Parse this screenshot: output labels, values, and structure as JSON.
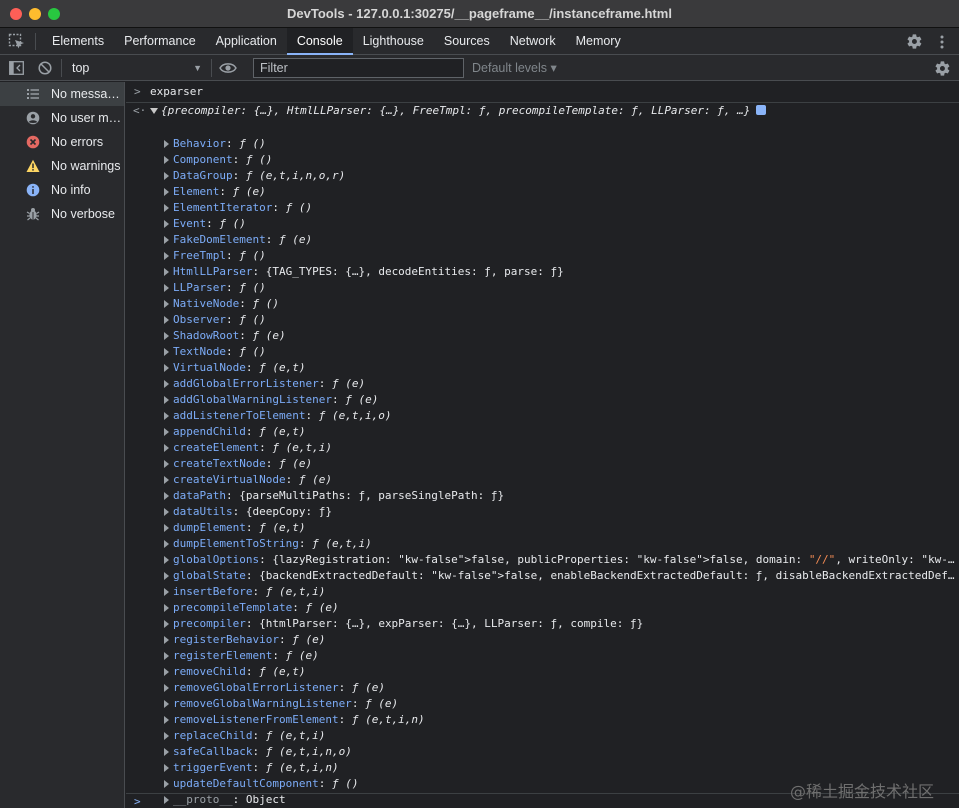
{
  "window": {
    "title": "DevTools - 127.0.0.1:30275/__pageframe__/instanceframe.html"
  },
  "tabs": [
    {
      "label": "Elements"
    },
    {
      "label": "Performance"
    },
    {
      "label": "Application"
    },
    {
      "label": "Console",
      "active": true
    },
    {
      "label": "Lighthouse"
    },
    {
      "label": "Sources"
    },
    {
      "label": "Network"
    },
    {
      "label": "Memory"
    }
  ],
  "toolbar": {
    "context": "top",
    "filter_placeholder": "Filter",
    "levels": "Default levels ▾"
  },
  "sidebar": {
    "items": [
      {
        "label": "No messages",
        "icon": "list-icon"
      },
      {
        "label": "No user me...",
        "icon": "user-icon"
      },
      {
        "label": "No errors",
        "icon": "error-icon"
      },
      {
        "label": "No warnings",
        "icon": "warning-icon"
      },
      {
        "label": "No info",
        "icon": "info-icon"
      },
      {
        "label": "No verbose",
        "icon": "bug-icon"
      }
    ]
  },
  "console": {
    "prompt": ">",
    "input": "exparser",
    "result_arrow": "<·",
    "result_summary": "{precompiler: {…}, HtmlLLParser: {…}, FreeTmpl: ƒ, precompileTemplate: ƒ, LLParser: ƒ, …}",
    "properties": [
      {
        "key": "Behavior",
        "value": "ƒ ()",
        "fn": true
      },
      {
        "key": "Component",
        "value": "ƒ ()",
        "fn": true
      },
      {
        "key": "DataGroup",
        "value": "ƒ (e,t,i,n,o,r)",
        "fn": true
      },
      {
        "key": "Element",
        "value": "ƒ (e)",
        "fn": true
      },
      {
        "key": "ElementIterator",
        "value": "ƒ ()",
        "fn": true
      },
      {
        "key": "Event",
        "value": "ƒ ()",
        "fn": true
      },
      {
        "key": "FakeDomElement",
        "value": "ƒ (e)",
        "fn": true
      },
      {
        "key": "FreeTmpl",
        "value": "ƒ ()",
        "fn": true
      },
      {
        "key": "HtmlLLParser",
        "value": "{TAG_TYPES: {…}, decodeEntities: ƒ, parse: ƒ}",
        "fn": false
      },
      {
        "key": "LLParser",
        "value": "ƒ ()",
        "fn": true
      },
      {
        "key": "NativeNode",
        "value": "ƒ ()",
        "fn": true
      },
      {
        "key": "Observer",
        "value": "ƒ ()",
        "fn": true
      },
      {
        "key": "ShadowRoot",
        "value": "ƒ (e)",
        "fn": true
      },
      {
        "key": "TextNode",
        "value": "ƒ ()",
        "fn": true
      },
      {
        "key": "VirtualNode",
        "value": "ƒ (e,t)",
        "fn": true
      },
      {
        "key": "addGlobalErrorListener",
        "value": "ƒ (e)",
        "fn": true
      },
      {
        "key": "addGlobalWarningListener",
        "value": "ƒ (e)",
        "fn": true
      },
      {
        "key": "addListenerToElement",
        "value": "ƒ (e,t,i,o)",
        "fn": true
      },
      {
        "key": "appendChild",
        "value": "ƒ (e,t)",
        "fn": true
      },
      {
        "key": "createElement",
        "value": "ƒ (e,t,i)",
        "fn": true
      },
      {
        "key": "createTextNode",
        "value": "ƒ (e)",
        "fn": true
      },
      {
        "key": "createVirtualNode",
        "value": "ƒ (e)",
        "fn": true
      },
      {
        "key": "dataPath",
        "value": "{parseMultiPaths: ƒ, parseSinglePath: ƒ}",
        "fn": false
      },
      {
        "key": "dataUtils",
        "value": "{deepCopy: ƒ}",
        "fn": false
      },
      {
        "key": "dumpElement",
        "value": "ƒ (e,t)",
        "fn": true
      },
      {
        "key": "dumpElementToString",
        "value": "ƒ (e,t,i)",
        "fn": true
      },
      {
        "key": "globalOptions",
        "value": "{lazyRegistration: false, publicProperties: false, domain: \"//\", writeOnly: false, availability: …",
        "fn": false
      },
      {
        "key": "globalState",
        "value": "{backendExtractedDefault: false, enableBackendExtractedDefault: ƒ, disableBackendExtractedDefault: …",
        "fn": false
      },
      {
        "key": "insertBefore",
        "value": "ƒ (e,t,i)",
        "fn": true
      },
      {
        "key": "precompileTemplate",
        "value": "ƒ (e)",
        "fn": true
      },
      {
        "key": "precompiler",
        "value": "{htmlParser: {…}, expParser: {…}, LLParser: ƒ, compile: ƒ}",
        "fn": false
      },
      {
        "key": "registerBehavior",
        "value": "ƒ (e)",
        "fn": true
      },
      {
        "key": "registerElement",
        "value": "ƒ (e)",
        "fn": true
      },
      {
        "key": "removeChild",
        "value": "ƒ (e,t)",
        "fn": true
      },
      {
        "key": "removeGlobalErrorListener",
        "value": "ƒ (e)",
        "fn": true
      },
      {
        "key": "removeGlobalWarningListener",
        "value": "ƒ (e)",
        "fn": true
      },
      {
        "key": "removeListenerFromElement",
        "value": "ƒ (e,t,i,n)",
        "fn": true
      },
      {
        "key": "replaceChild",
        "value": "ƒ (e,t,i)",
        "fn": true
      },
      {
        "key": "safeCallback",
        "value": "ƒ (e,t,i,n,o)",
        "fn": true
      },
      {
        "key": "triggerEvent",
        "value": "ƒ (e,t,i,n)",
        "fn": true
      },
      {
        "key": "updateDefaultComponent",
        "value": "ƒ ()",
        "fn": true
      },
      {
        "key": "__proto__",
        "value": "Object",
        "fn": false,
        "proto": true
      }
    ],
    "bottom_prompt": ">"
  },
  "watermark": "@稀土掘金技术社区",
  "colors": {
    "accent": "#8ab4f8",
    "property_key": "#7cacf8",
    "keyword_false": "#9980ff",
    "string": "#f28b54",
    "error": "#e46962",
    "warning": "#fdd663"
  }
}
